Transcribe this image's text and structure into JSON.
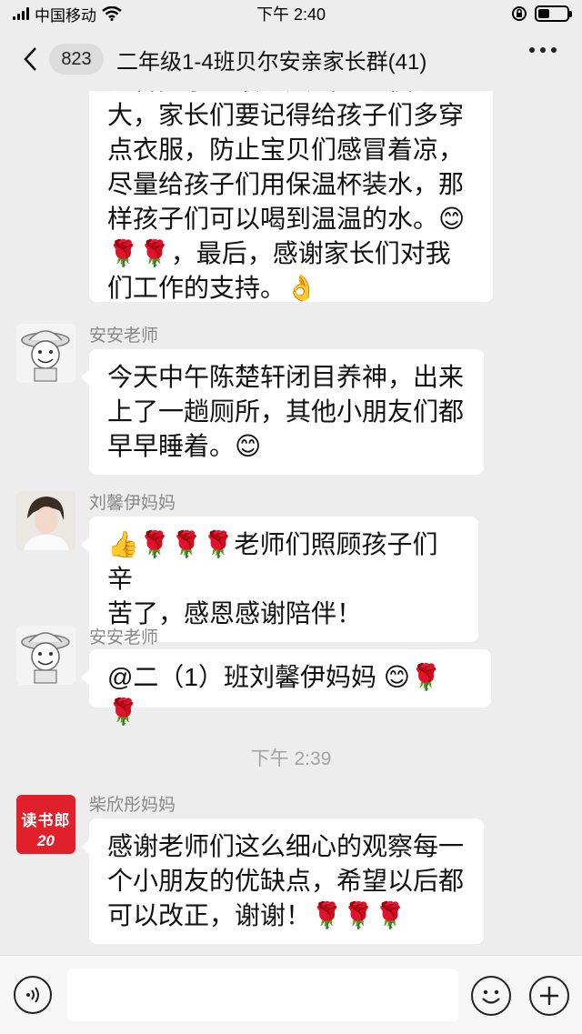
{
  "status_bar": {
    "carrier": "中国移动",
    "time": "下午 2:40"
  },
  "nav": {
    "unread_count": "823",
    "title": "二年级1-4班贝尔安亲家长群(41)"
  },
  "messages": [
    {
      "sender": "",
      "lines": [
        "温馨提示：最近天气一昼夜温差",
        "大，家长们要记得给孩子们多穿",
        "点衣服，防止宝贝们感冒着凉，",
        "尽量给孩子们用保温杯装水，那",
        "样孩子们可以喝到温温的水。😊",
        "🌹🌹，最后，感谢家长们对我",
        "们工作的支持。👌"
      ]
    },
    {
      "sender": "安安老师",
      "lines": [
        "今天中午陈楚轩闭目养神，出来",
        "上了一趟厕所，其他小朋友们都",
        "早早睡着。😊"
      ]
    },
    {
      "sender": "刘馨伊妈妈",
      "lines": [
        "👍🌹🌹🌹老师们照顾孩子们辛",
        "苦了，感恩感谢陪伴！"
      ]
    },
    {
      "sender": "安安老师",
      "lines": [
        "@二（1）班刘馨伊妈妈 😊🌹🌹"
      ]
    },
    {
      "sender": "柴欣彤妈妈",
      "lines": [
        "感谢老师们这么细心的观察每一",
        "个小朋友的优缺点，希望以后都",
        "可以改正，谢谢！🌹🌹🌹"
      ]
    }
  ],
  "time_divider": "下午 2:39",
  "avatar_text": {
    "brand": "读书郎",
    "number": "20"
  },
  "colors": {
    "background": "#ededed",
    "bubble": "#ffffff",
    "sender_text": "#888888",
    "brand_red": "#e0212b"
  },
  "icons": {
    "back": "chevron-left-icon",
    "more": "more-dots-icon",
    "voice": "voice-icon",
    "emoji": "emoji-face-icon",
    "plus": "plus-icon"
  }
}
